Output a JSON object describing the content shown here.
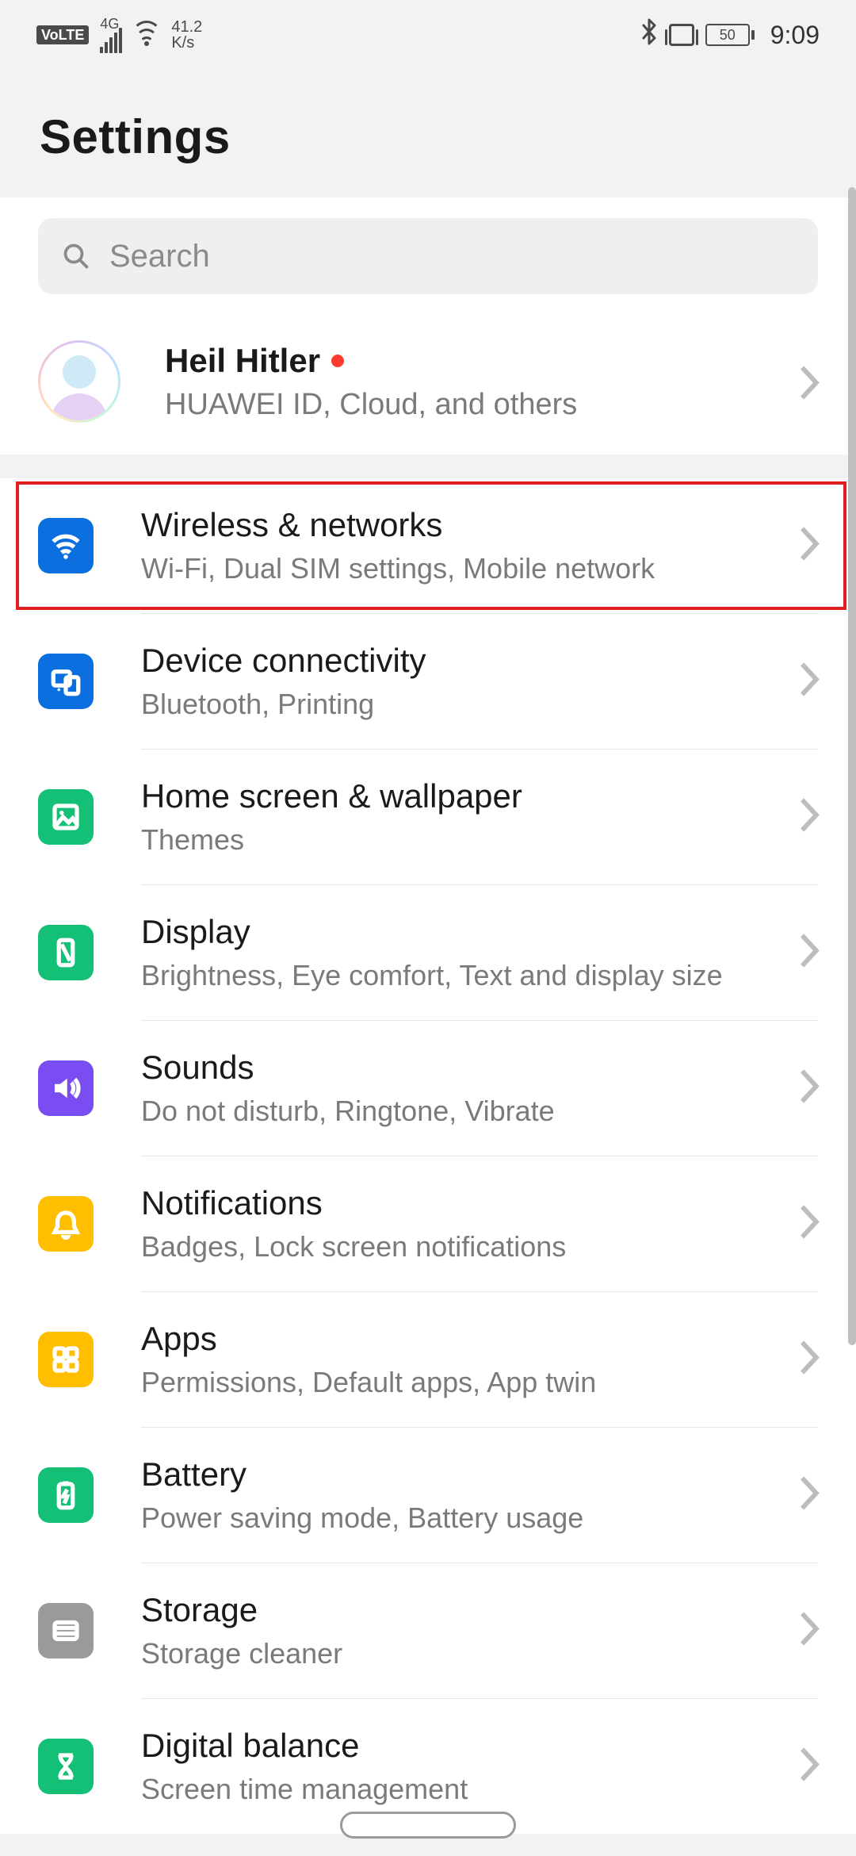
{
  "status": {
    "volte": "VoLTE",
    "net_gen": "4G",
    "speed_top": "41.2",
    "speed_bot": "K/s",
    "battery": "50",
    "clock": "9:09"
  },
  "header": {
    "title": "Settings"
  },
  "search": {
    "placeholder": "Search"
  },
  "account": {
    "name": "Heil Hitler",
    "sub": "HUAWEI ID, Cloud, and others"
  },
  "items": [
    {
      "key": "wireless",
      "title": "Wireless & networks",
      "sub": "Wi-Fi, Dual SIM settings, Mobile network",
      "icon": "wifi",
      "color": "blue",
      "highlighted": true
    },
    {
      "key": "device-connectivity",
      "title": "Device connectivity",
      "sub": "Bluetooth, Printing",
      "icon": "cast",
      "color": "blue"
    },
    {
      "key": "home-wallpaper",
      "title": "Home screen & wallpaper",
      "sub": "Themes",
      "icon": "picture",
      "color": "green"
    },
    {
      "key": "display",
      "title": "Display",
      "sub": "Brightness, Eye comfort, Text and display size",
      "icon": "phone",
      "color": "green"
    },
    {
      "key": "sounds",
      "title": "Sounds",
      "sub": "Do not disturb, Ringtone, Vibrate",
      "icon": "speaker",
      "color": "purple"
    },
    {
      "key": "notifications",
      "title": "Notifications",
      "sub": "Badges, Lock screen notifications",
      "icon": "bell",
      "color": "yellow"
    },
    {
      "key": "apps",
      "title": "Apps",
      "sub": "Permissions, Default apps, App twin",
      "icon": "grid",
      "color": "yellow"
    },
    {
      "key": "battery",
      "title": "Battery",
      "sub": "Power saving mode, Battery usage",
      "icon": "battery",
      "color": "green"
    },
    {
      "key": "storage",
      "title": "Storage",
      "sub": "Storage cleaner",
      "icon": "drive",
      "color": "grey"
    },
    {
      "key": "digital-balance",
      "title": "Digital balance",
      "sub": "Screen time management",
      "icon": "hourglass",
      "color": "green"
    }
  ]
}
